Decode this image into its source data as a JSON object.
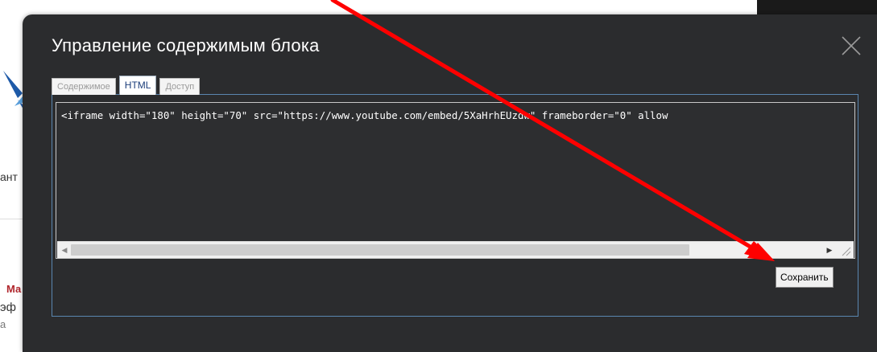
{
  "background": {
    "text_1": "ант",
    "text_2": "Ма",
    "text_3": "эф",
    "text_4": "а"
  },
  "modal": {
    "title": "Управление содержимым блока",
    "close_icon": "close-icon"
  },
  "tabs": [
    {
      "label": "Содержимое",
      "active": false
    },
    {
      "label": "HTML",
      "active": true
    },
    {
      "label": "Доступ",
      "active": false
    }
  ],
  "editor": {
    "code": "<iframe width=\"180\" height=\"70\" src=\"https://www.youtube.com/embed/5XaHrhEUzdw\" frameborder=\"0\" allow"
  },
  "buttons": {
    "save_label": "Сохранить"
  },
  "colors": {
    "modal_bg": "#2b2c2e",
    "panel_border": "#5a86b0",
    "arrow": "#ff0000"
  }
}
